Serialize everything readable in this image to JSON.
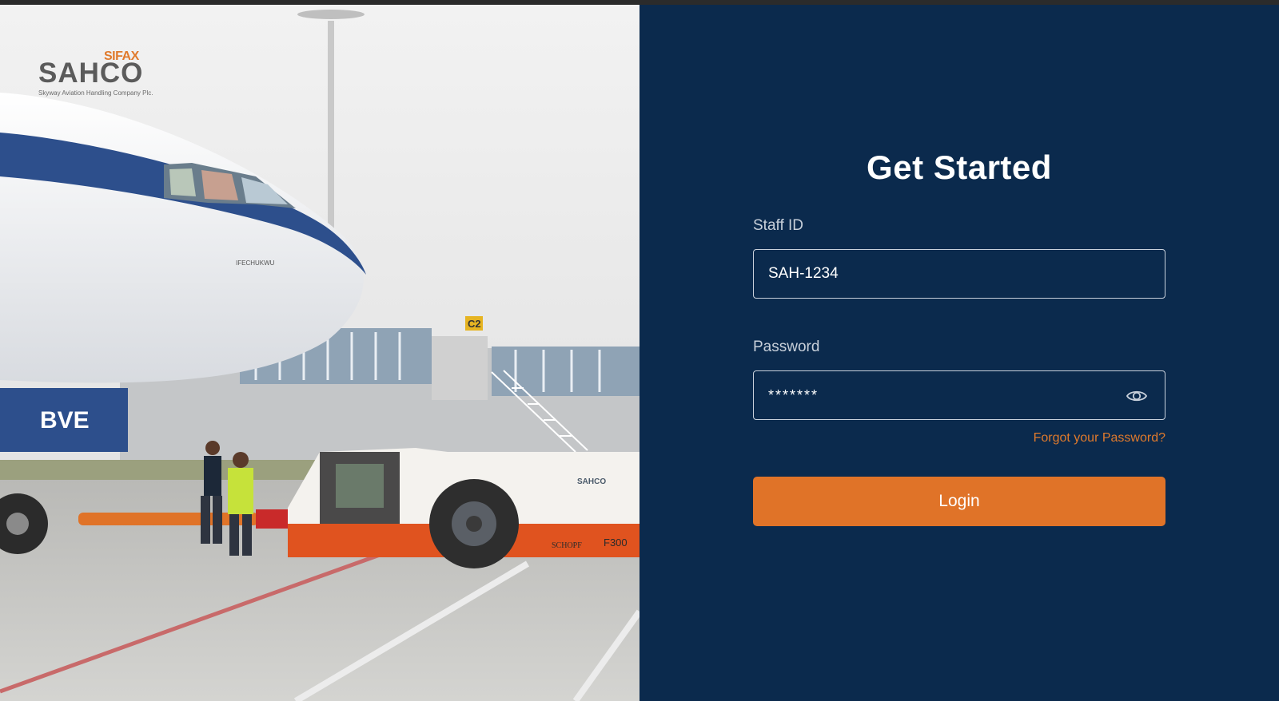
{
  "brand": {
    "sub_brand": "SIFAX",
    "name": "SAHCO",
    "tagline": "Skyway Aviation Handling Company Plc.",
    "accent_color": "#e07328",
    "panel_color": "#0b2a4d"
  },
  "hero": {
    "aircraft_registration": "BVE",
    "aircraft_nose_name": "IFECHUKWU",
    "gate_sign": "C2",
    "tug_brand": "SAHCO",
    "tug_maker": "SCHOPF",
    "tug_model": "F300"
  },
  "form": {
    "title": "Get Started",
    "staff_id": {
      "label": "Staff ID",
      "value": "SAH-1234"
    },
    "password": {
      "label": "Password",
      "value": "*******",
      "toggle_icon": "eye-icon"
    },
    "forgot_link": "Forgot your Password?",
    "submit_label": "Login"
  }
}
